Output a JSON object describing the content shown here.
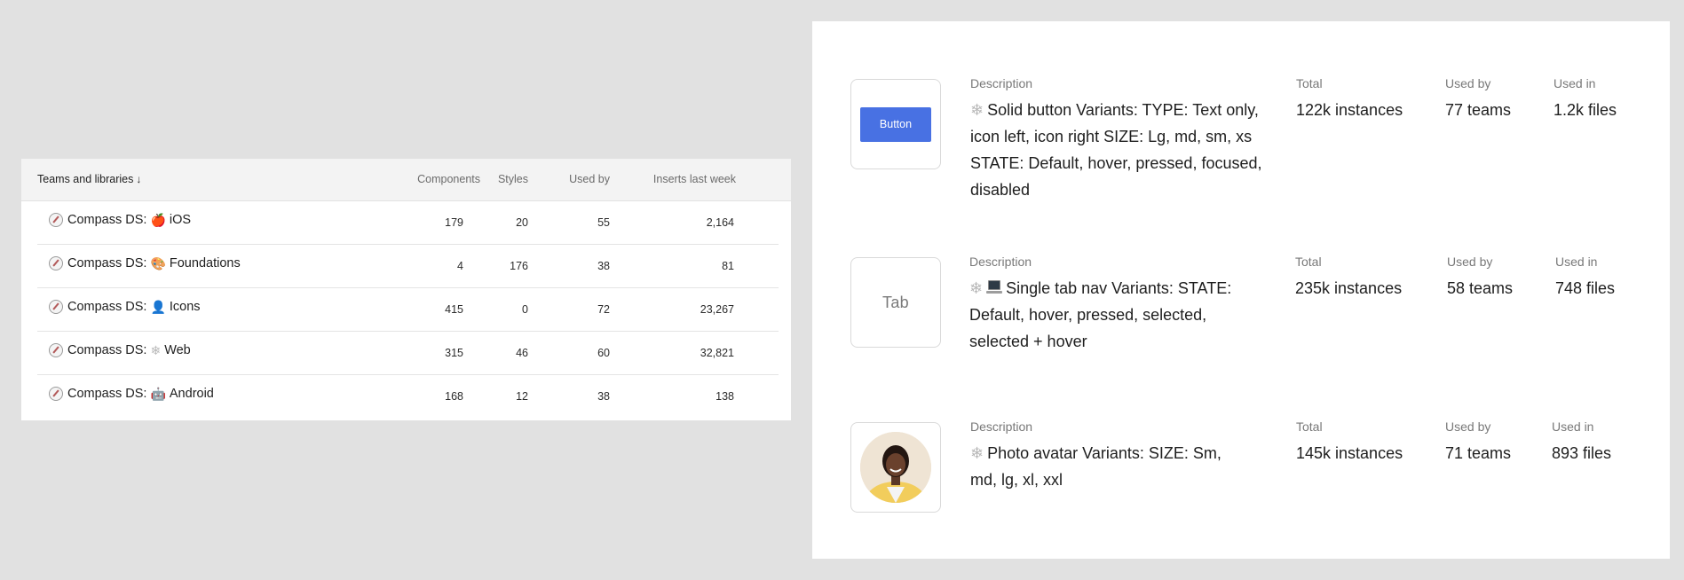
{
  "table": {
    "headers": {
      "name": "Teams and libraries",
      "sort_arrow": "↓",
      "components": "Components",
      "styles": "Styles",
      "used_by": "Used by",
      "inserts": "Inserts last week"
    },
    "rows": [
      {
        "prefix": "Compass DS:",
        "emoji": "🍎",
        "name": "iOS",
        "components": "179",
        "styles": "20",
        "used_by": "55",
        "inserts": "2,164"
      },
      {
        "prefix": "Compass DS:",
        "emoji": "🎨",
        "name": "Foundations",
        "components": "4",
        "styles": "176",
        "used_by": "38",
        "inserts": "81"
      },
      {
        "prefix": "Compass DS:",
        "emoji": "👤",
        "name": "Icons",
        "components": "415",
        "styles": "0",
        "used_by": "72",
        "inserts": "23,267"
      },
      {
        "prefix": "Compass DS:",
        "emoji": "❄",
        "name": "Web",
        "components": "315",
        "styles": "46",
        "used_by": "60",
        "inserts": "32,821"
      },
      {
        "prefix": "Compass DS:",
        "emoji": "🤖",
        "name": "Android",
        "components": "168",
        "styles": "12",
        "used_by": "38",
        "inserts": "138"
      }
    ]
  },
  "components": {
    "labels": {
      "description": "Description",
      "total": "Total",
      "used_by": "Used by",
      "used_in": "Used in"
    },
    "items": [
      {
        "preview": "Button",
        "description": "Solid button Variants: TYPE: Text only, icon left, icon right SIZE: Lg, md, sm, xs STATE: Default, hover, pressed, focused, disabled",
        "total": "122k instances",
        "used_by": "77 teams",
        "used_in": "1.2k files"
      },
      {
        "preview": "Tab",
        "description": "Single tab nav Variants: STATE: Default, hover, pressed, selected, selected + hover",
        "total": "235k instances",
        "used_by": "58 teams",
        "used_in": "748 files"
      },
      {
        "preview": "",
        "description": "Photo avatar Variants: SIZE: Sm, md, lg, xl, xxl",
        "total": "145k instances",
        "used_by": "71 teams",
        "used_in": "893 files"
      }
    ]
  },
  "icons": {
    "compass": "compass-icon",
    "snowflake": "snowflake-icon",
    "laptop": "laptop-icon"
  },
  "colors": {
    "background": "#e1e1e1",
    "button_blue": "#4871e3",
    "header_bg": "#f3f3f3"
  }
}
